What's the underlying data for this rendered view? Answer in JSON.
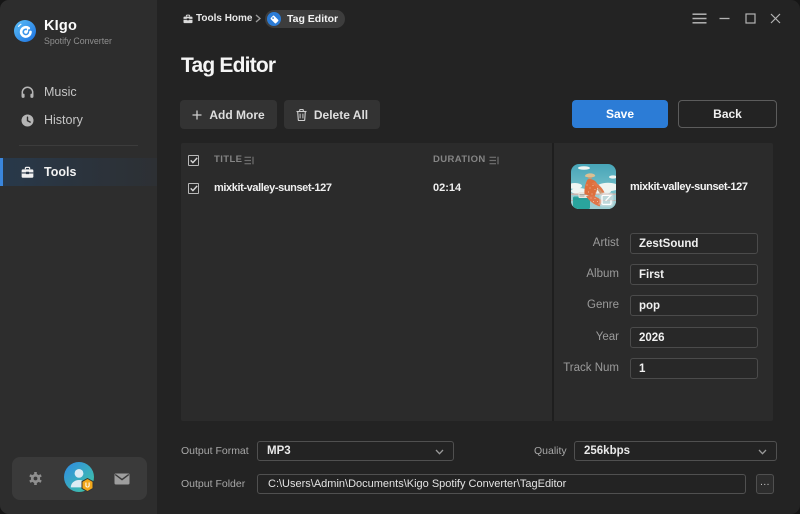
{
  "app": {
    "name": "KIgo",
    "subtitle": "Spotify Converter"
  },
  "sidebar": {
    "items": [
      {
        "label": "Music"
      },
      {
        "label": "History"
      },
      {
        "label": "Tools",
        "active": true
      }
    ]
  },
  "account": {
    "icons": [
      "settings-gear",
      "user-avatar",
      "mail-envelope"
    ],
    "avatar_badge": "U"
  },
  "titlebar": {
    "breadcrumb_root": "Tools Home",
    "breadcrumb_separator": "›",
    "breadcrumb_current": "Tag Editor",
    "window_controls": [
      "menu",
      "minimize",
      "maximize",
      "close"
    ]
  },
  "page": {
    "title": "Tag Editor"
  },
  "toolbar": {
    "add_more": "Add More",
    "delete_all": "Delete All",
    "save": "Save",
    "back": "Back"
  },
  "table": {
    "columns": [
      "TITLE",
      "DURATION"
    ],
    "rows": [
      {
        "checked": true,
        "title": "mixkit-valley-sunset-127",
        "duration": "02:14"
      }
    ],
    "header_checked": true
  },
  "detail": {
    "track_name": "mixkit-valley-sunset-127",
    "fields": [
      {
        "label": "Artist",
        "value": "ZestSound"
      },
      {
        "label": "Album",
        "value": "First"
      },
      {
        "label": "Genre",
        "value": "pop"
      },
      {
        "label": "Year",
        "value": "2026"
      },
      {
        "label": "Track Num",
        "value": "1"
      }
    ]
  },
  "output": {
    "format_label": "Output Format",
    "format_value": "MP3",
    "quality_label": "Quality",
    "quality_value": "256kbps",
    "folder_label": "Output Folder",
    "folder_value": "C:\\Users\\Admin\\Documents\\Kigo Spotify Converter\\TagEditor",
    "browse": "..."
  },
  "colors": {
    "accent_blue": "#2c7cd6",
    "sidebar_bg": "#2d2d2d",
    "main_bg": "#232323",
    "panel_bg": "#2b2b2b",
    "avatar_gradient": [
      "#2f87e0",
      "#3fc4a4"
    ],
    "badge_orange": "#f2a71b"
  }
}
